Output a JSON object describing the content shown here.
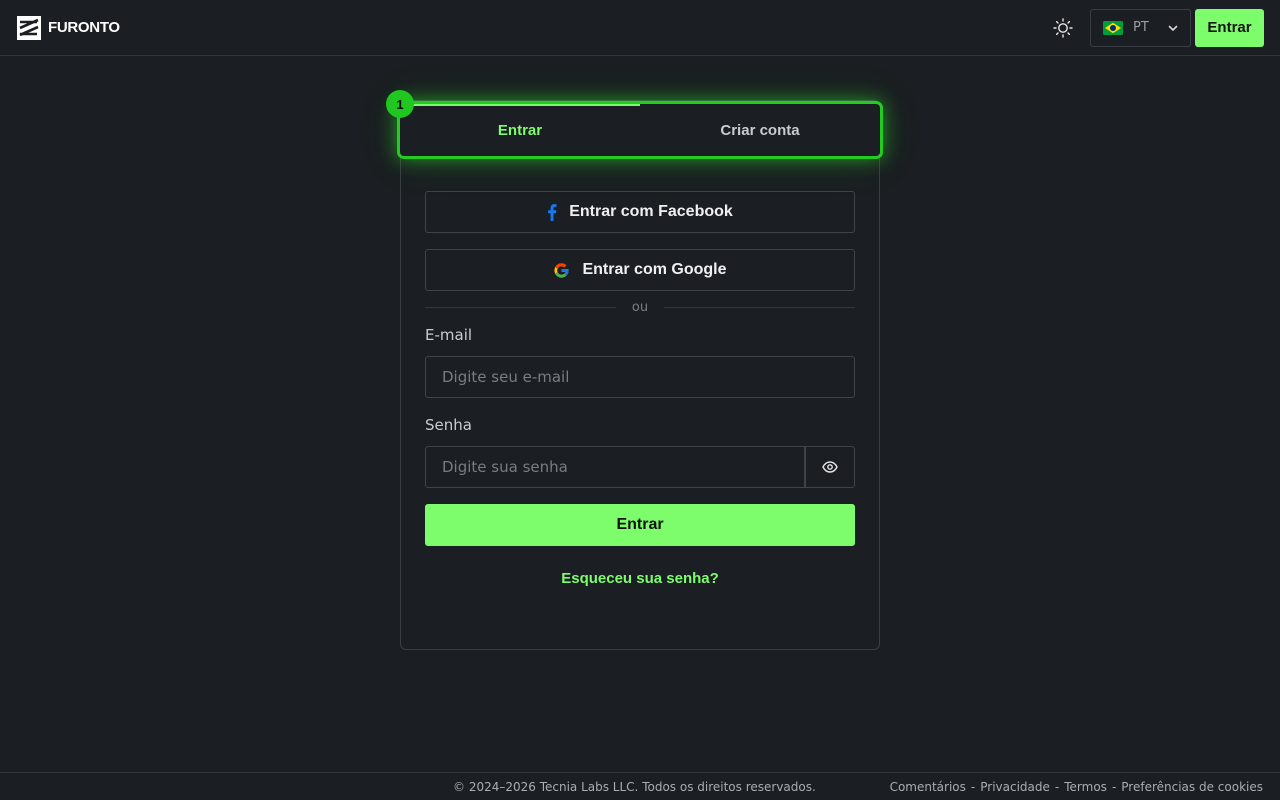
{
  "header": {
    "brand_name": "FURONTO",
    "language_code": "PT",
    "login_label": "Entrar",
    "theme_icon": "sun-icon",
    "flag_icon": "brazil-flag-icon"
  },
  "tabs": {
    "badge": "1",
    "login": "Entrar",
    "signup": "Criar conta"
  },
  "social": {
    "facebook_label": "Entrar com Facebook",
    "google_label": "Entrar com Google"
  },
  "divider_text": "ou",
  "form": {
    "email_label": "E-mail",
    "email_placeholder": "Digite seu e-mail",
    "password_label": "Senha",
    "password_placeholder": "Digite sua senha",
    "submit_label": "Entrar",
    "forgot_label": "Esqueceu sua senha?"
  },
  "footer": {
    "copyright": "© 2024–2026 Tecnia Labs LLC. Todos os direitos reservados.",
    "links": [
      "Comentários",
      "Privacidade",
      "Termos",
      "Preferências de cookies"
    ],
    "separator": "-"
  },
  "colors": {
    "accent": "#7dfc6c",
    "glow": "#22cc22",
    "background": "#1b1e22"
  }
}
